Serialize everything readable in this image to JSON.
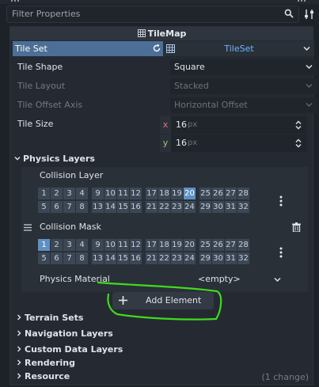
{
  "filter": {
    "placeholder": "Filter Properties"
  },
  "header": {
    "title": "TileMap"
  },
  "tile_set": {
    "label": "Tile Set",
    "value": "TileSet"
  },
  "properties": [
    {
      "label": "Tile Shape",
      "value": "Square"
    },
    {
      "label": "Tile Layout",
      "value": "Stacked"
    },
    {
      "label": "Tile Offset Axis",
      "value": "Horizontal Offset"
    }
  ],
  "tile_size": {
    "label": "Tile Size",
    "x_axis": "x",
    "y_axis": "y",
    "x": "16",
    "y": "16",
    "unit": "px"
  },
  "physics_layers": {
    "title": "Physics Layers",
    "collision_layer": {
      "label": "Collision Layer",
      "active": [
        20
      ]
    },
    "collision_mask": {
      "label": "Collision Mask",
      "active": [
        1
      ]
    },
    "bit_numbers": {
      "row1": [
        1,
        2,
        3,
        4,
        9,
        10,
        11,
        12,
        17,
        18,
        19,
        20,
        25,
        26,
        27,
        28
      ],
      "row2": [
        5,
        6,
        7,
        8,
        13,
        14,
        15,
        16,
        21,
        22,
        23,
        24,
        29,
        30,
        31,
        32
      ]
    },
    "physics_material": {
      "label": "Physics Material",
      "value": "<empty>"
    },
    "add_button": "Add Element"
  },
  "sections": [
    {
      "label": "Terrain Sets"
    },
    {
      "label": "Navigation Layers"
    },
    {
      "label": "Custom Data Layers"
    },
    {
      "label": "Rendering"
    },
    {
      "label": "Resource"
    }
  ],
  "resource_note": "(1 change)",
  "colors": {
    "accent": "#4b6f97",
    "bit_on": "#5f90c4",
    "annotation": "#3fdc1c"
  }
}
